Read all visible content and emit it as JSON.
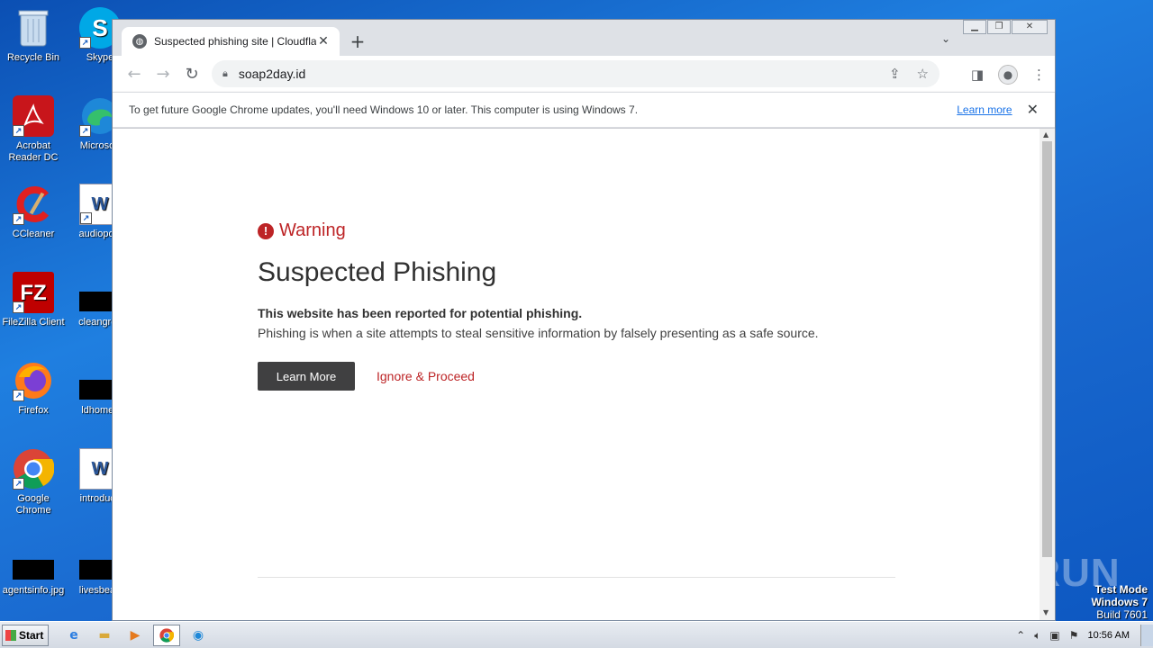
{
  "desktop": {
    "icons": [
      {
        "label": "Recycle Bin"
      },
      {
        "label": "Skype"
      },
      {
        "label": "Acrobat Reader DC"
      },
      {
        "label": "Microsoft"
      },
      {
        "label": "CCleaner"
      },
      {
        "label": "audiopolit"
      },
      {
        "label": "FileZilla Client"
      },
      {
        "label": "cleangrov"
      },
      {
        "label": "Firefox"
      },
      {
        "label": "ldhomes"
      },
      {
        "label": "Google Chrome"
      },
      {
        "label": "introducti"
      },
      {
        "label": "agentsinfo.jpg"
      },
      {
        "label": "livesbead"
      }
    ],
    "watermark": "ANY RUN",
    "test_mode": {
      "line1": "Test Mode",
      "line2": "Windows 7",
      "line3": "Build 7601"
    }
  },
  "browser": {
    "tab_title": "Suspected phishing site | Cloudflare",
    "url": "soap2day.id",
    "infobar": {
      "message": "To get future Google Chrome updates, you'll need Windows 10 or later. This computer is using Windows 7.",
      "link": "Learn more"
    }
  },
  "page": {
    "warning_label": "Warning",
    "title": "Suspected Phishing",
    "bold_line": "This website has been reported for potential phishing.",
    "description": "Phishing is when a site attempts to steal sensitive information by falsely presenting as a safe source.",
    "learn_more_button": "Learn More",
    "proceed_link": "Ignore & Proceed"
  },
  "taskbar": {
    "start_label": "Start",
    "clock": "10:56 AM"
  },
  "colors": {
    "warning_red": "#bd2426",
    "button_dark": "#404041",
    "desktop_blue": "#1f7fe0"
  }
}
